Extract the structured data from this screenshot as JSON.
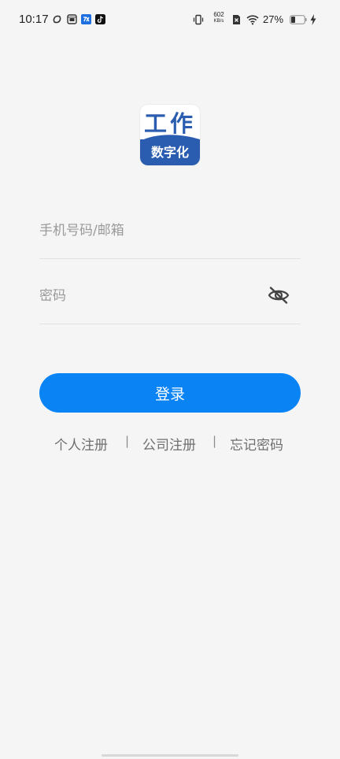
{
  "status_bar": {
    "time": "10:17",
    "net_speed_value": "602",
    "net_speed_unit": "KB/s",
    "battery_percent": "27%",
    "icons": [
      "sync-icon",
      "sim-card-icon",
      "app-notification-icon",
      "tiktok-icon",
      "vibrate-icon",
      "no-sim-icon",
      "wifi-icon",
      "battery-icon",
      "charging-icon"
    ]
  },
  "logo": {
    "top_text": "工作",
    "bottom_text": "数字化",
    "colors": {
      "primary": "#2a5db0",
      "background": "#ffffff"
    }
  },
  "form": {
    "account_placeholder": "手机号码/邮箱",
    "account_value": "",
    "password_placeholder": "密码",
    "password_value": "",
    "password_visibility_icon": "eye-slash-icon"
  },
  "login_button": {
    "label": "登录",
    "color": "#0a84f5"
  },
  "links": {
    "personal_register": "个人注册",
    "company_register": "公司注册",
    "forgot_password": "忘记密码",
    "separator": "|"
  }
}
